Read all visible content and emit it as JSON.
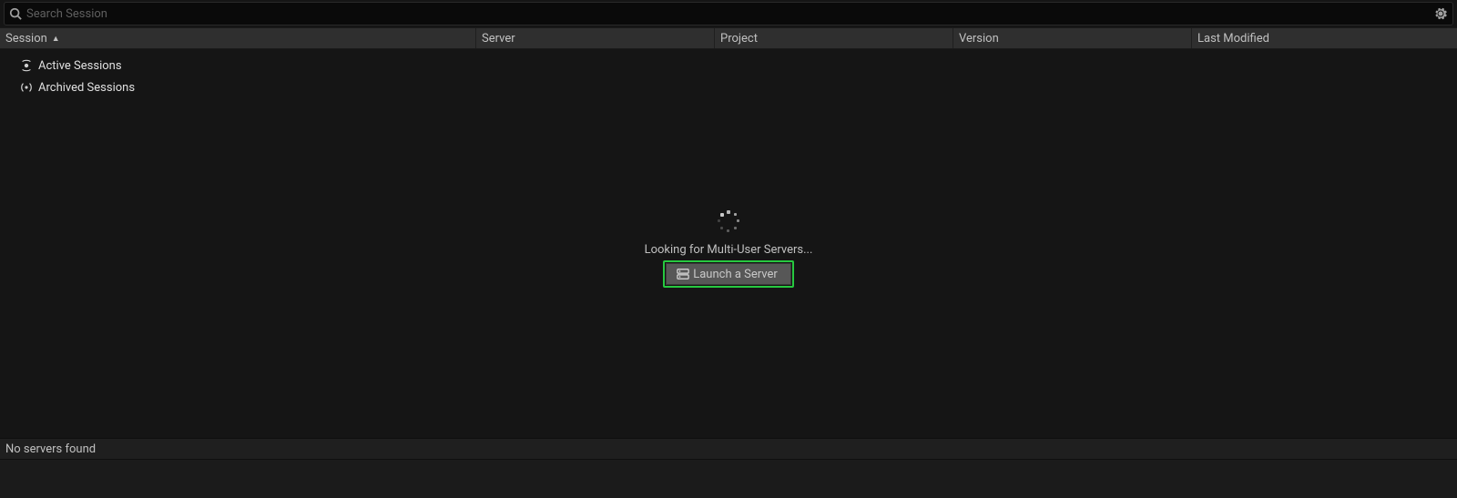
{
  "search": {
    "placeholder": "Search Session"
  },
  "columns": {
    "session": "Session",
    "server": "Server",
    "project": "Project",
    "version": "Version",
    "lastModified": "Last Modified"
  },
  "tree": {
    "activeSessions": "Active Sessions",
    "archivedSessions": "Archived Sessions"
  },
  "main": {
    "lookingText": "Looking for Multi-User Servers...",
    "launchButton": "Launch a Server"
  },
  "status": {
    "text": "No servers found"
  }
}
